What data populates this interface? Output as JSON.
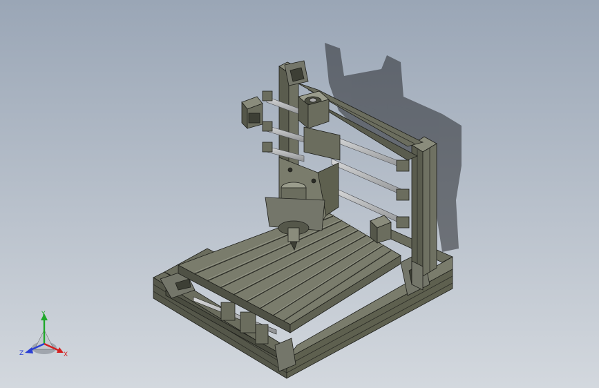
{
  "viewport": {
    "background_top": "#9aa6b6",
    "background_bottom": "#d3d8de",
    "model_color": "#6b6d5e",
    "model_dark": "#3d3f35",
    "model_light": "#8a8c7c",
    "edge_color": "#1e1f1b",
    "shadow_color": "#2a2c30"
  },
  "triad": {
    "x_label": "X",
    "y_label": "Y",
    "z_label": "Z",
    "x_color": "#d42020",
    "y_color": "#1fa82a",
    "z_color": "#2a3fd4"
  }
}
